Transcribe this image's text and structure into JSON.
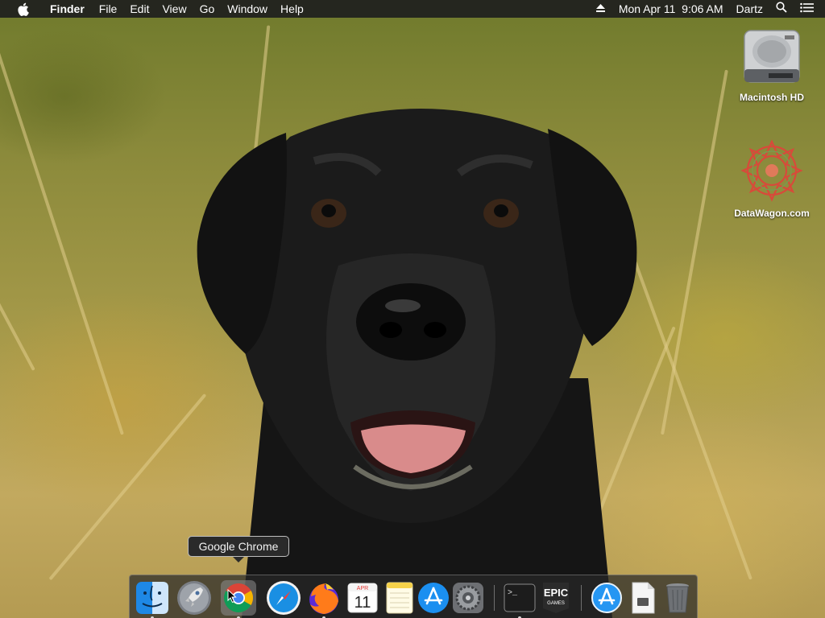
{
  "menubar": {
    "apple_icon": "apple-logo-icon",
    "app_name": "Finder",
    "menus": [
      "File",
      "Edit",
      "View",
      "Go",
      "Window",
      "Help"
    ],
    "eject_icon": "eject-icon",
    "datetime": "Mon Apr 11  9:06 AM",
    "user": "Dartz",
    "search_icon": "spotlight-search-icon",
    "notification_icon": "notification-center-icon"
  },
  "desktop": {
    "icons": [
      {
        "label": "Macintosh HD",
        "icon": "hard-drive-icon"
      },
      {
        "label": "DataWagon.com",
        "icon": "mandala-icon"
      }
    ]
  },
  "tooltip": {
    "text": "Google Chrome"
  },
  "calendar_icon": {
    "month": "APR",
    "day": "11"
  },
  "epic_icon": {
    "line1": "EPIC",
    "line2": "GAMES"
  },
  "dock": {
    "items": [
      {
        "name": "Finder",
        "icon": "finder-icon",
        "running": true
      },
      {
        "name": "Launchpad",
        "icon": "launchpad-icon",
        "running": false
      },
      {
        "name": "Google Chrome",
        "icon": "chrome-icon",
        "running": true
      },
      {
        "name": "Safari",
        "icon": "safari-icon",
        "running": false
      },
      {
        "name": "Firefox",
        "icon": "firefox-icon",
        "running": true
      },
      {
        "name": "Calendar",
        "icon": "calendar-icon",
        "running": false
      },
      {
        "name": "Notes",
        "icon": "notes-icon",
        "running": false
      },
      {
        "name": "App Store",
        "icon": "app-store-icon",
        "running": false
      },
      {
        "name": "System Preferences",
        "icon": "system-preferences-icon",
        "running": false
      },
      {
        "name": "Terminal",
        "icon": "terminal-icon",
        "running": true
      },
      {
        "name": "Epic Games Launcher",
        "icon": "epic-games-icon",
        "running": false
      },
      {
        "name": "App Store Downloads",
        "icon": "app-store-folder-icon",
        "running": false
      },
      {
        "name": "Documents",
        "icon": "document-stack-icon",
        "running": false
      },
      {
        "name": "Trash",
        "icon": "trash-icon",
        "running": false
      }
    ]
  },
  "colors": {
    "menubar_bg": "#1e1e1e",
    "dock_bg": "#282828",
    "chrome_red": "#db4437",
    "chrome_yellow": "#f4b400",
    "chrome_green": "#0f9d58",
    "chrome_blue": "#4285f4"
  }
}
